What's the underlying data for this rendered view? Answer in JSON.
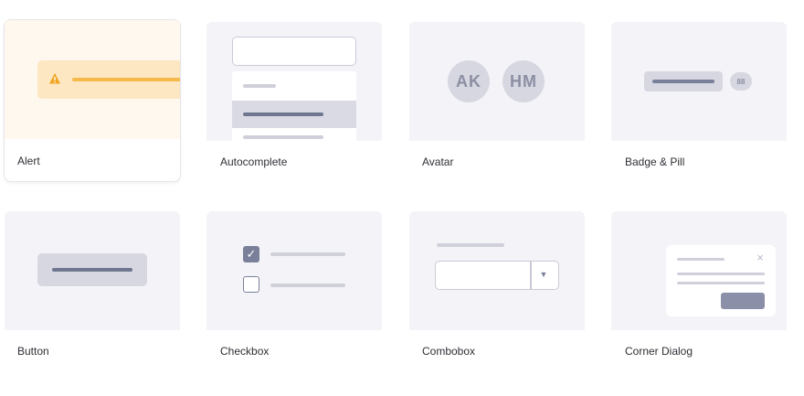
{
  "components": [
    {
      "label": "Alert"
    },
    {
      "label": "Autocomplete"
    },
    {
      "label": "Avatar",
      "initials": [
        "AK",
        "HM"
      ]
    },
    {
      "label": "Badge & Pill",
      "badge_count": "88"
    },
    {
      "label": "Button"
    },
    {
      "label": "Checkbox"
    },
    {
      "label": "Combobox"
    },
    {
      "label": "Corner Dialog"
    }
  ],
  "colors": {
    "thumb_bg": "#f4f4f8",
    "alert_bg": "#fde7c2",
    "alert_accent": "#f5b94c",
    "muted": "#d6d7e1",
    "ink": "#6f7690"
  }
}
